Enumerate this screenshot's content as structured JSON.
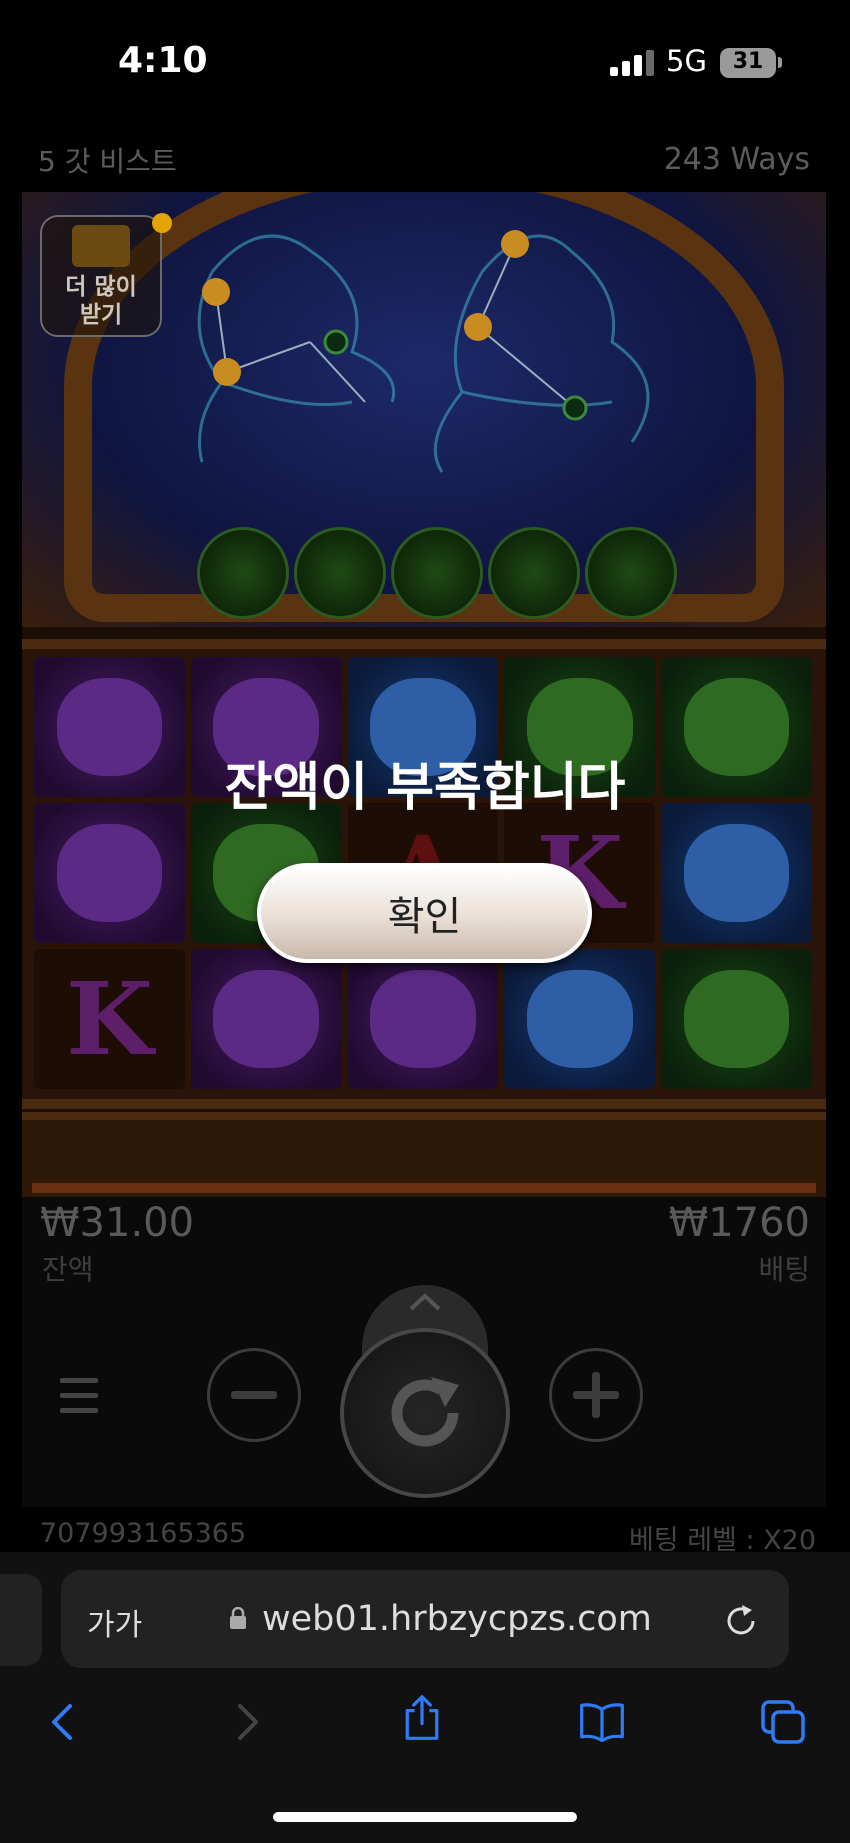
{
  "status_bar": {
    "time": "4:10",
    "network": "5G",
    "battery": "31"
  },
  "game": {
    "title": "5 갓 비스트",
    "ways": "243 Ways",
    "bonus_badge": "더 많이\n받기",
    "reels": [
      [
        "purple-beast",
        "purple-beast",
        "blue-tiger",
        "green-phoenix",
        "green-phoenix"
      ],
      [
        "purple-beast",
        "green-phoenix",
        "A",
        "K",
        "blue-tiger"
      ],
      [
        "K",
        "purple-dragon",
        "purple-dragon",
        "blue-tiger",
        "green-phoenix"
      ]
    ]
  },
  "dialog": {
    "message": "잔액이 부족합니다",
    "confirm_label": "확인"
  },
  "controls": {
    "balance_value": "₩31.00",
    "balance_label": "잔액",
    "bet_value": "₩1760",
    "bet_label": "배팅",
    "minus_icon": "minus-icon",
    "plus_icon": "plus-icon",
    "spin_icon": "spin-icon",
    "game_id": "707993165365",
    "bet_level": "베팅 레벨 : X20"
  },
  "browser": {
    "text_size_label": "가가",
    "url": "web01.hrbzycpzs.com",
    "accent_color": "#2f7bf6"
  }
}
